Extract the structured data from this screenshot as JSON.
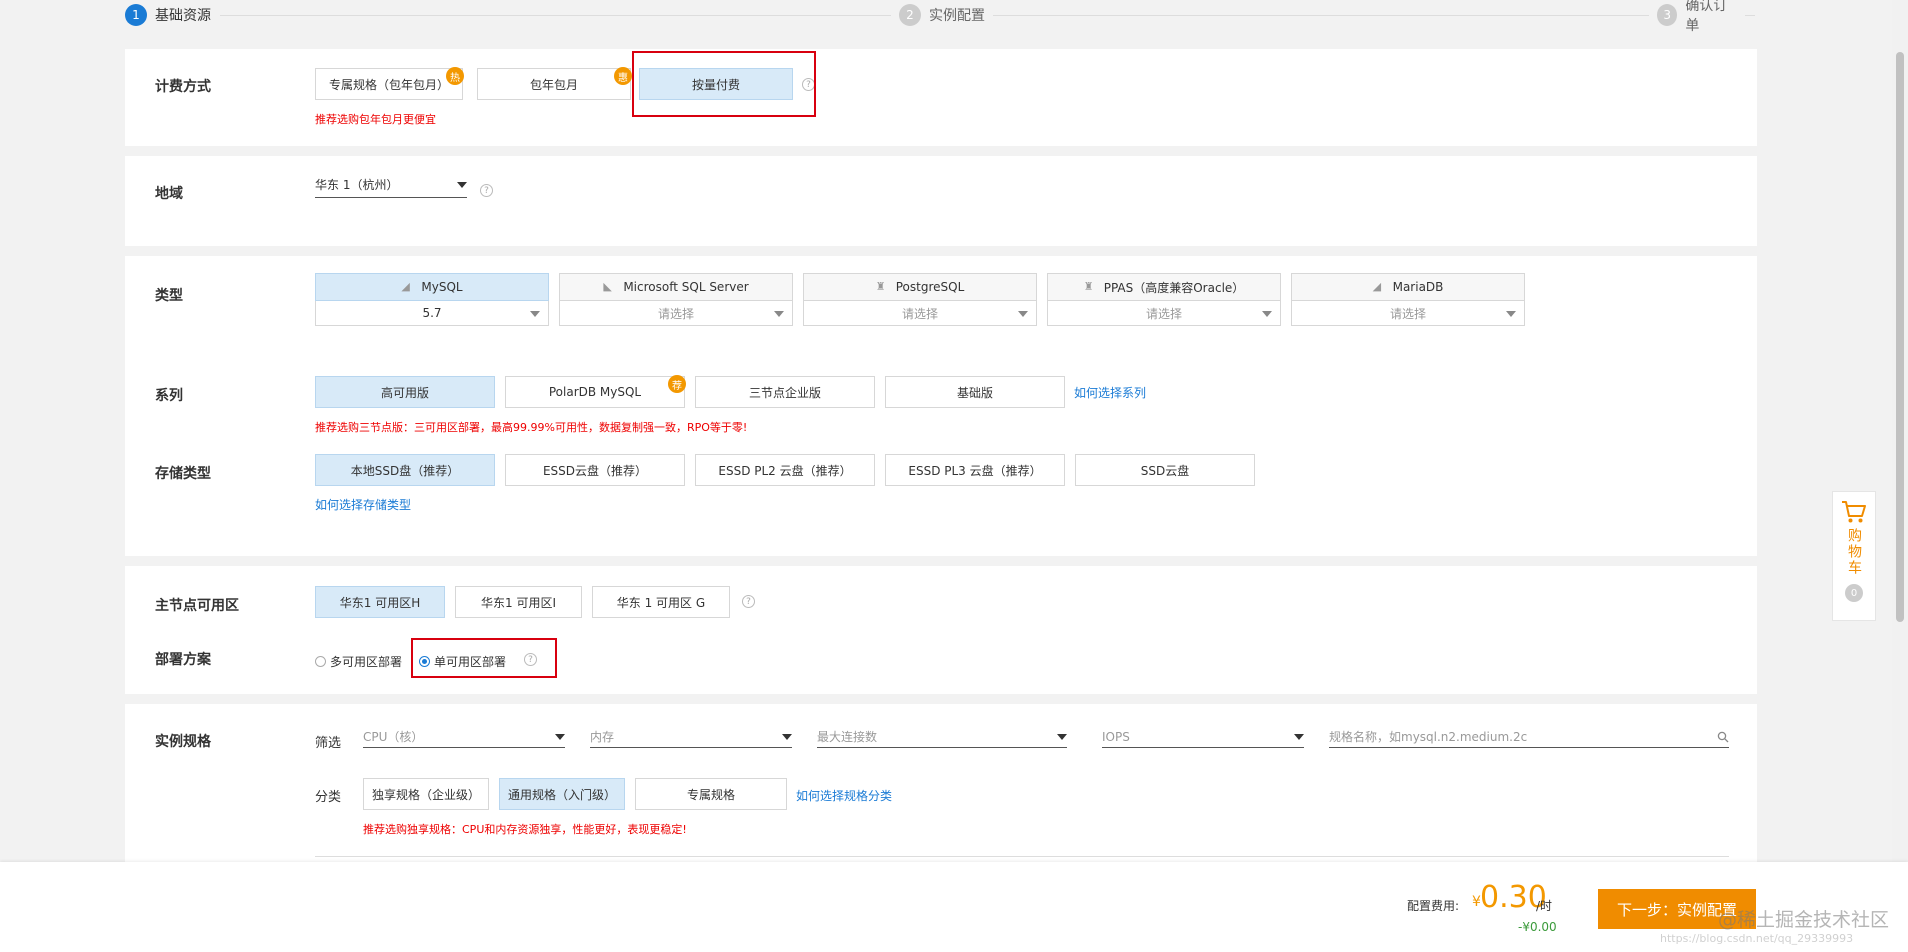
{
  "steps": [
    {
      "num": "1",
      "label": "基础资源"
    },
    {
      "num": "2",
      "label": "实例配置"
    },
    {
      "num": "3",
      "label": "确认订单"
    }
  ],
  "billing": {
    "label": "计费方式",
    "options": [
      "专属规格（包年包月）",
      "包年包月",
      "按量付费"
    ],
    "badges": [
      "热",
      "惠"
    ],
    "hint": "推荐选购包年包月更便宜"
  },
  "region": {
    "label": "地域",
    "value": "华东 1（杭州）"
  },
  "dbtype": {
    "label": "类型",
    "engines": [
      {
        "name": "MySQL",
        "version": "5.7"
      },
      {
        "name": "Microsoft SQL Server",
        "version": "请选择"
      },
      {
        "name": "PostgreSQL",
        "version": "请选择"
      },
      {
        "name": "PPAS（高度兼容Oracle）",
        "version": "请选择"
      },
      {
        "name": "MariaDB",
        "version": "请选择"
      }
    ]
  },
  "series": {
    "label": "系列",
    "options": [
      "高可用版",
      "PolarDB MySQL",
      "三节点企业版",
      "基础版"
    ],
    "badge": "荐",
    "link": "如何选择系列",
    "hint": "推荐选购三节点版：三可用区部署，最高99.99%可用性，数据复制强一致，RPO等于零!"
  },
  "storage": {
    "label": "存储类型",
    "options": [
      "本地SSD盘（推荐）",
      "ESSD云盘（推荐）",
      "ESSD PL2 云盘（推荐）",
      "ESSD PL3 云盘（推荐）",
      "SSD云盘"
    ],
    "link": "如何选择存储类型"
  },
  "zone": {
    "label": "主节点可用区",
    "options": [
      "华东1 可用区H",
      "华东1 可用区I",
      "华东 1 可用区 G"
    ]
  },
  "deploy": {
    "label": "部署方案",
    "options": [
      "多可用区部署",
      "单可用区部署"
    ]
  },
  "spec": {
    "label": "实例规格",
    "filter_label": "筛选",
    "filters": [
      "CPU（核）",
      "内存",
      "最大连接数",
      "IOPS"
    ],
    "search_placeholder": "规格名称，如mysql.n2.medium.2c",
    "category_label": "分类",
    "categories": [
      "独享规格（企业级）",
      "通用规格（入门级）",
      "专属规格"
    ],
    "link": "如何选择规格分类",
    "hint": "推荐选购独享规格：CPU和内存资源独享，性能更好，表现更稳定!"
  },
  "footer": {
    "fee_label": "配置费用:",
    "currency": "¥",
    "price": "0.30",
    "unit": "/时",
    "discount": "-¥0.00",
    "next": "下一步：实例配置",
    "watermark": "@稀土掘金技术社区",
    "watermark2": "https://blog.csdn.net/qq_29339993"
  },
  "cart": {
    "label": "购物车",
    "count": "0"
  },
  "colors": {
    "accent": "#1a7bd5",
    "orange": "#f08c00",
    "selected_bg": "#d8eaf8",
    "hint_red": "#e00000",
    "highlight_box": "#d8000f"
  }
}
